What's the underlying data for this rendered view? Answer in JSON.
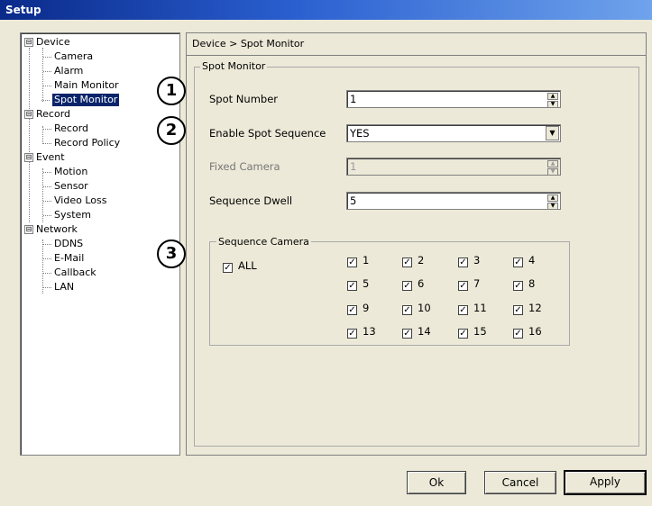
{
  "window": {
    "title": "Setup"
  },
  "tree": {
    "groups": [
      {
        "label": "Device",
        "expander": "⊟",
        "children": [
          "Camera",
          "Alarm",
          "Main Monitor",
          "Spot Monitor"
        ]
      },
      {
        "label": "Record",
        "expander": "⊟",
        "children": [
          "Record",
          "Record Policy"
        ]
      },
      {
        "label": "Event",
        "expander": "⊟",
        "children": [
          "Motion",
          "Sensor",
          "Video Loss",
          "System"
        ]
      },
      {
        "label": "Network",
        "expander": "⊟",
        "children": [
          "DDNS",
          "E-Mail",
          "Callback",
          "LAN"
        ]
      }
    ],
    "selected": "Spot Monitor"
  },
  "breadcrumb": "Device > Spot Monitor",
  "spot_monitor": {
    "legend": "Spot Monitor",
    "spot_number": {
      "label": "Spot Number",
      "value": "1"
    },
    "enable_sequence": {
      "label": "Enable Spot Sequence",
      "value": "YES"
    },
    "fixed_camera": {
      "label": "Fixed Camera",
      "value": "1"
    },
    "sequence_dwell": {
      "label": "Sequence Dwell",
      "value": "5"
    }
  },
  "sequence_camera": {
    "legend": "Sequence Camera",
    "all_label": "ALL",
    "cameras": [
      "1",
      "2",
      "3",
      "4",
      "5",
      "6",
      "7",
      "8",
      "9",
      "10",
      "11",
      "12",
      "13",
      "14",
      "15",
      "16"
    ]
  },
  "callouts": [
    "1",
    "2",
    "3"
  ],
  "buttons": {
    "ok": "Ok",
    "cancel": "Cancel",
    "apply": "Apply"
  },
  "glyphs": {
    "check": "✓",
    "dropdown": "▼",
    "spin_up": "▲",
    "spin_down": "▼"
  }
}
